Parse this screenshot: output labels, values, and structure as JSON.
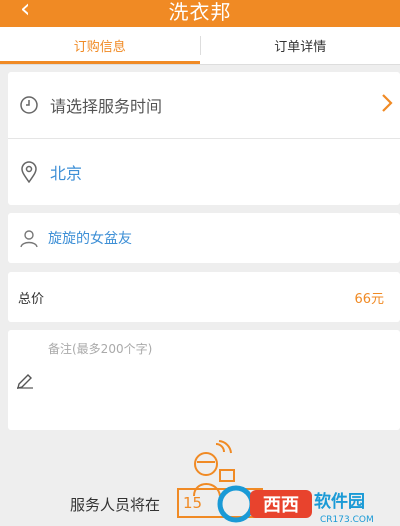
{
  "header": {
    "back_icon": "chevron-left-icon",
    "title": "洗衣邦"
  },
  "tabs": [
    {
      "label": "订购信息",
      "active": true
    },
    {
      "label": "订单详情",
      "active": false
    }
  ],
  "service": {
    "time_placeholder": "请选择服务时间",
    "city": "北京"
  },
  "user": {
    "name": "旋旋的女盆友"
  },
  "price": {
    "label": "总价",
    "value": "66元"
  },
  "note": {
    "placeholder": "备注(最多200个字)"
  },
  "footer": {
    "text": "服务人员将在",
    "countdown_partial": "15"
  },
  "colors": {
    "accent": "#f08a24",
    "link": "#3d8fd6",
    "background": "#eeeeee"
  },
  "watermark": {
    "text": "西西软件园",
    "subtext": "CR173.COM"
  }
}
